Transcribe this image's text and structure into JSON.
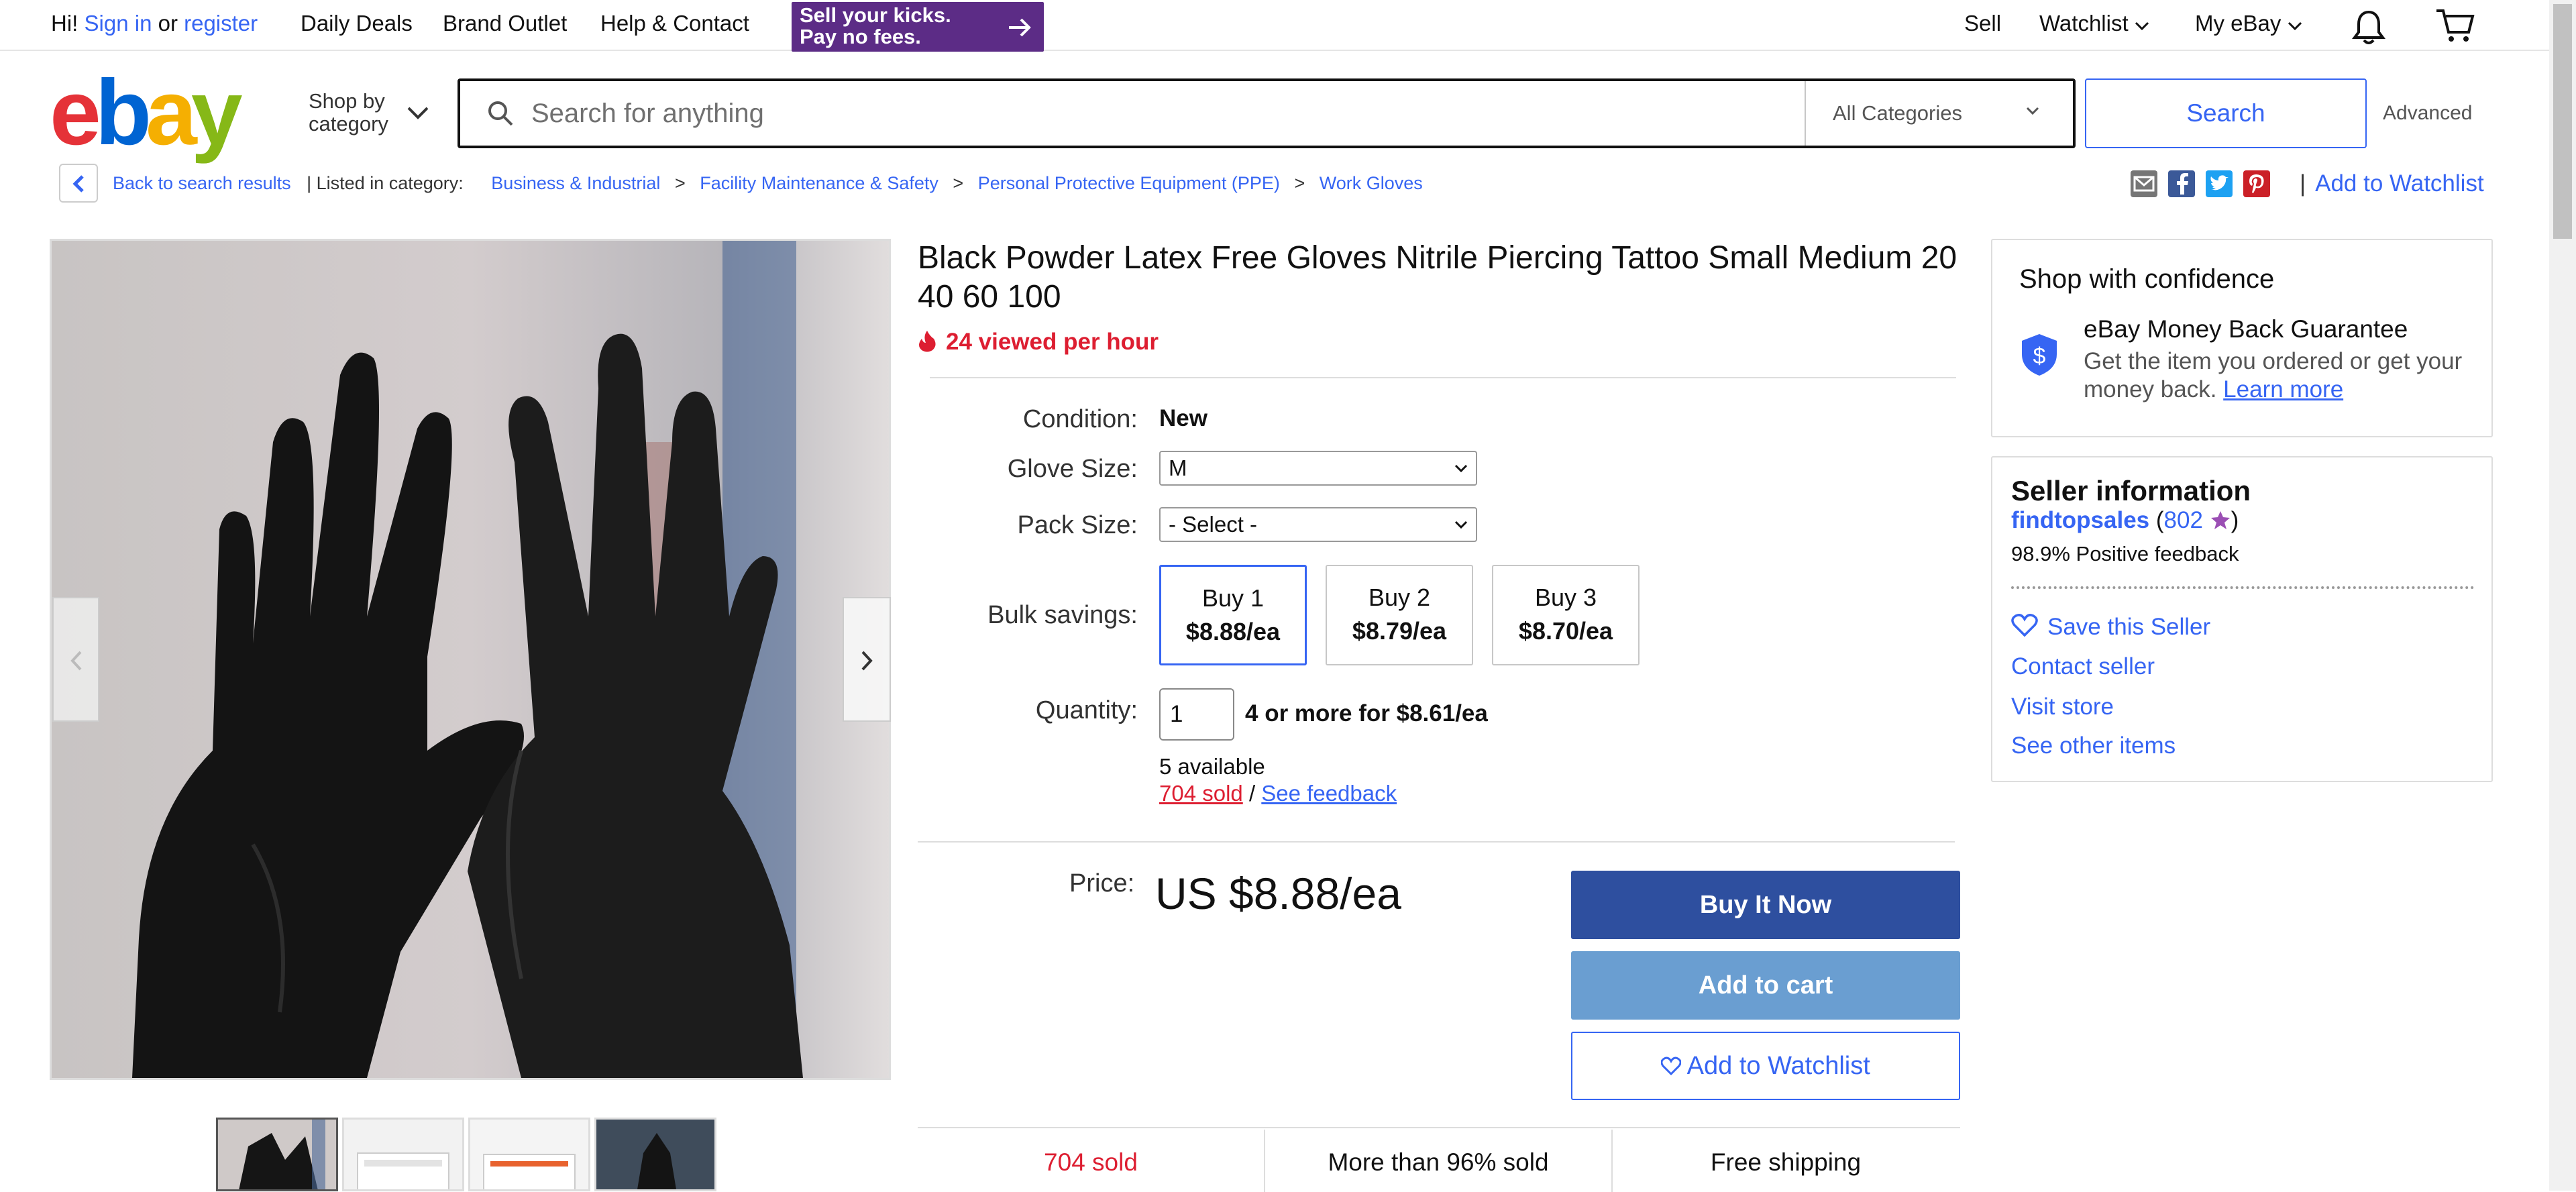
{
  "topnav": {
    "greeting": "Hi!",
    "sign_in": "Sign in",
    "or": "or",
    "register": "register",
    "daily_deals": "Daily Deals",
    "brand_outlet": "Brand Outlet",
    "help_contact": "Help & Contact",
    "promo_line1": "Sell your kicks.",
    "promo_line2": "Pay no fees.",
    "sell": "Sell",
    "watchlist": "Watchlist",
    "my_ebay": "My eBay"
  },
  "header": {
    "logo_letters": [
      "e",
      "b",
      "a",
      "y"
    ],
    "logo_colors": [
      "#e53238",
      "#0064d2",
      "#f5af02",
      "#86b817"
    ],
    "shop_by_line1": "Shop by",
    "shop_by_line2": "category",
    "search_placeholder": "Search for anything",
    "category": "All Categories",
    "search_button": "Search",
    "advanced": "Advanced"
  },
  "breadcrumb": {
    "back": "Back to search results",
    "listed_in": "| Listed in category:",
    "items": [
      "Business & Industrial",
      "Facility Maintenance & Safety",
      "Personal Protective Equipment (PPE)",
      "Work Gloves"
    ],
    "separator": ">",
    "add_to_watchlist": "Add to Watchlist"
  },
  "listing": {
    "title": "Black Powder Latex Free Gloves Nitrile Piercing Tattoo Small Medium 20 40 60 100",
    "viewed": "24 viewed per hour",
    "condition_label": "Condition:",
    "condition": "New",
    "glove_size_label": "Glove Size:",
    "glove_size": "M",
    "pack_size_label": "Pack Size:",
    "pack_size": "- Select -",
    "bulk_label": "Bulk savings:",
    "bulk": [
      {
        "qty": "Buy 1",
        "price": "$8.88/ea"
      },
      {
        "qty": "Buy 2",
        "price": "$8.79/ea"
      },
      {
        "qty": "Buy 3",
        "price": "$8.70/ea"
      }
    ],
    "quantity_label": "Quantity:",
    "quantity": "1",
    "quantity_deal": "4 or more for $8.61/ea",
    "available": "5 available",
    "sold": "704 sold",
    "slash": "/",
    "see_feedback": "See feedback",
    "price_label": "Price:",
    "price": "US $8.88/ea",
    "buy_now": "Buy It Now",
    "add_cart": "Add to cart",
    "add_watchlist": "Add to Watchlist",
    "stats": [
      "704 sold",
      "More than 96% sold",
      "Free shipping"
    ]
  },
  "confidence": {
    "title": "Shop with confidence",
    "guarantee_title": "eBay Money Back Guarantee",
    "guarantee_text": "Get the item you ordered or get your money back.",
    "learn_more": "Learn more"
  },
  "seller": {
    "title": "Seller information",
    "name": "findtopsales",
    "score": "802",
    "feedback": "98.9% Positive feedback",
    "save": "Save this Seller",
    "contact": "Contact seller",
    "visit": "Visit store",
    "other": "See other items"
  },
  "colors": {
    "link": "#3665f3",
    "buy_now": "#2e4f9f",
    "add_cart": "#6a9ed1",
    "urgent": "#dd1e31"
  }
}
